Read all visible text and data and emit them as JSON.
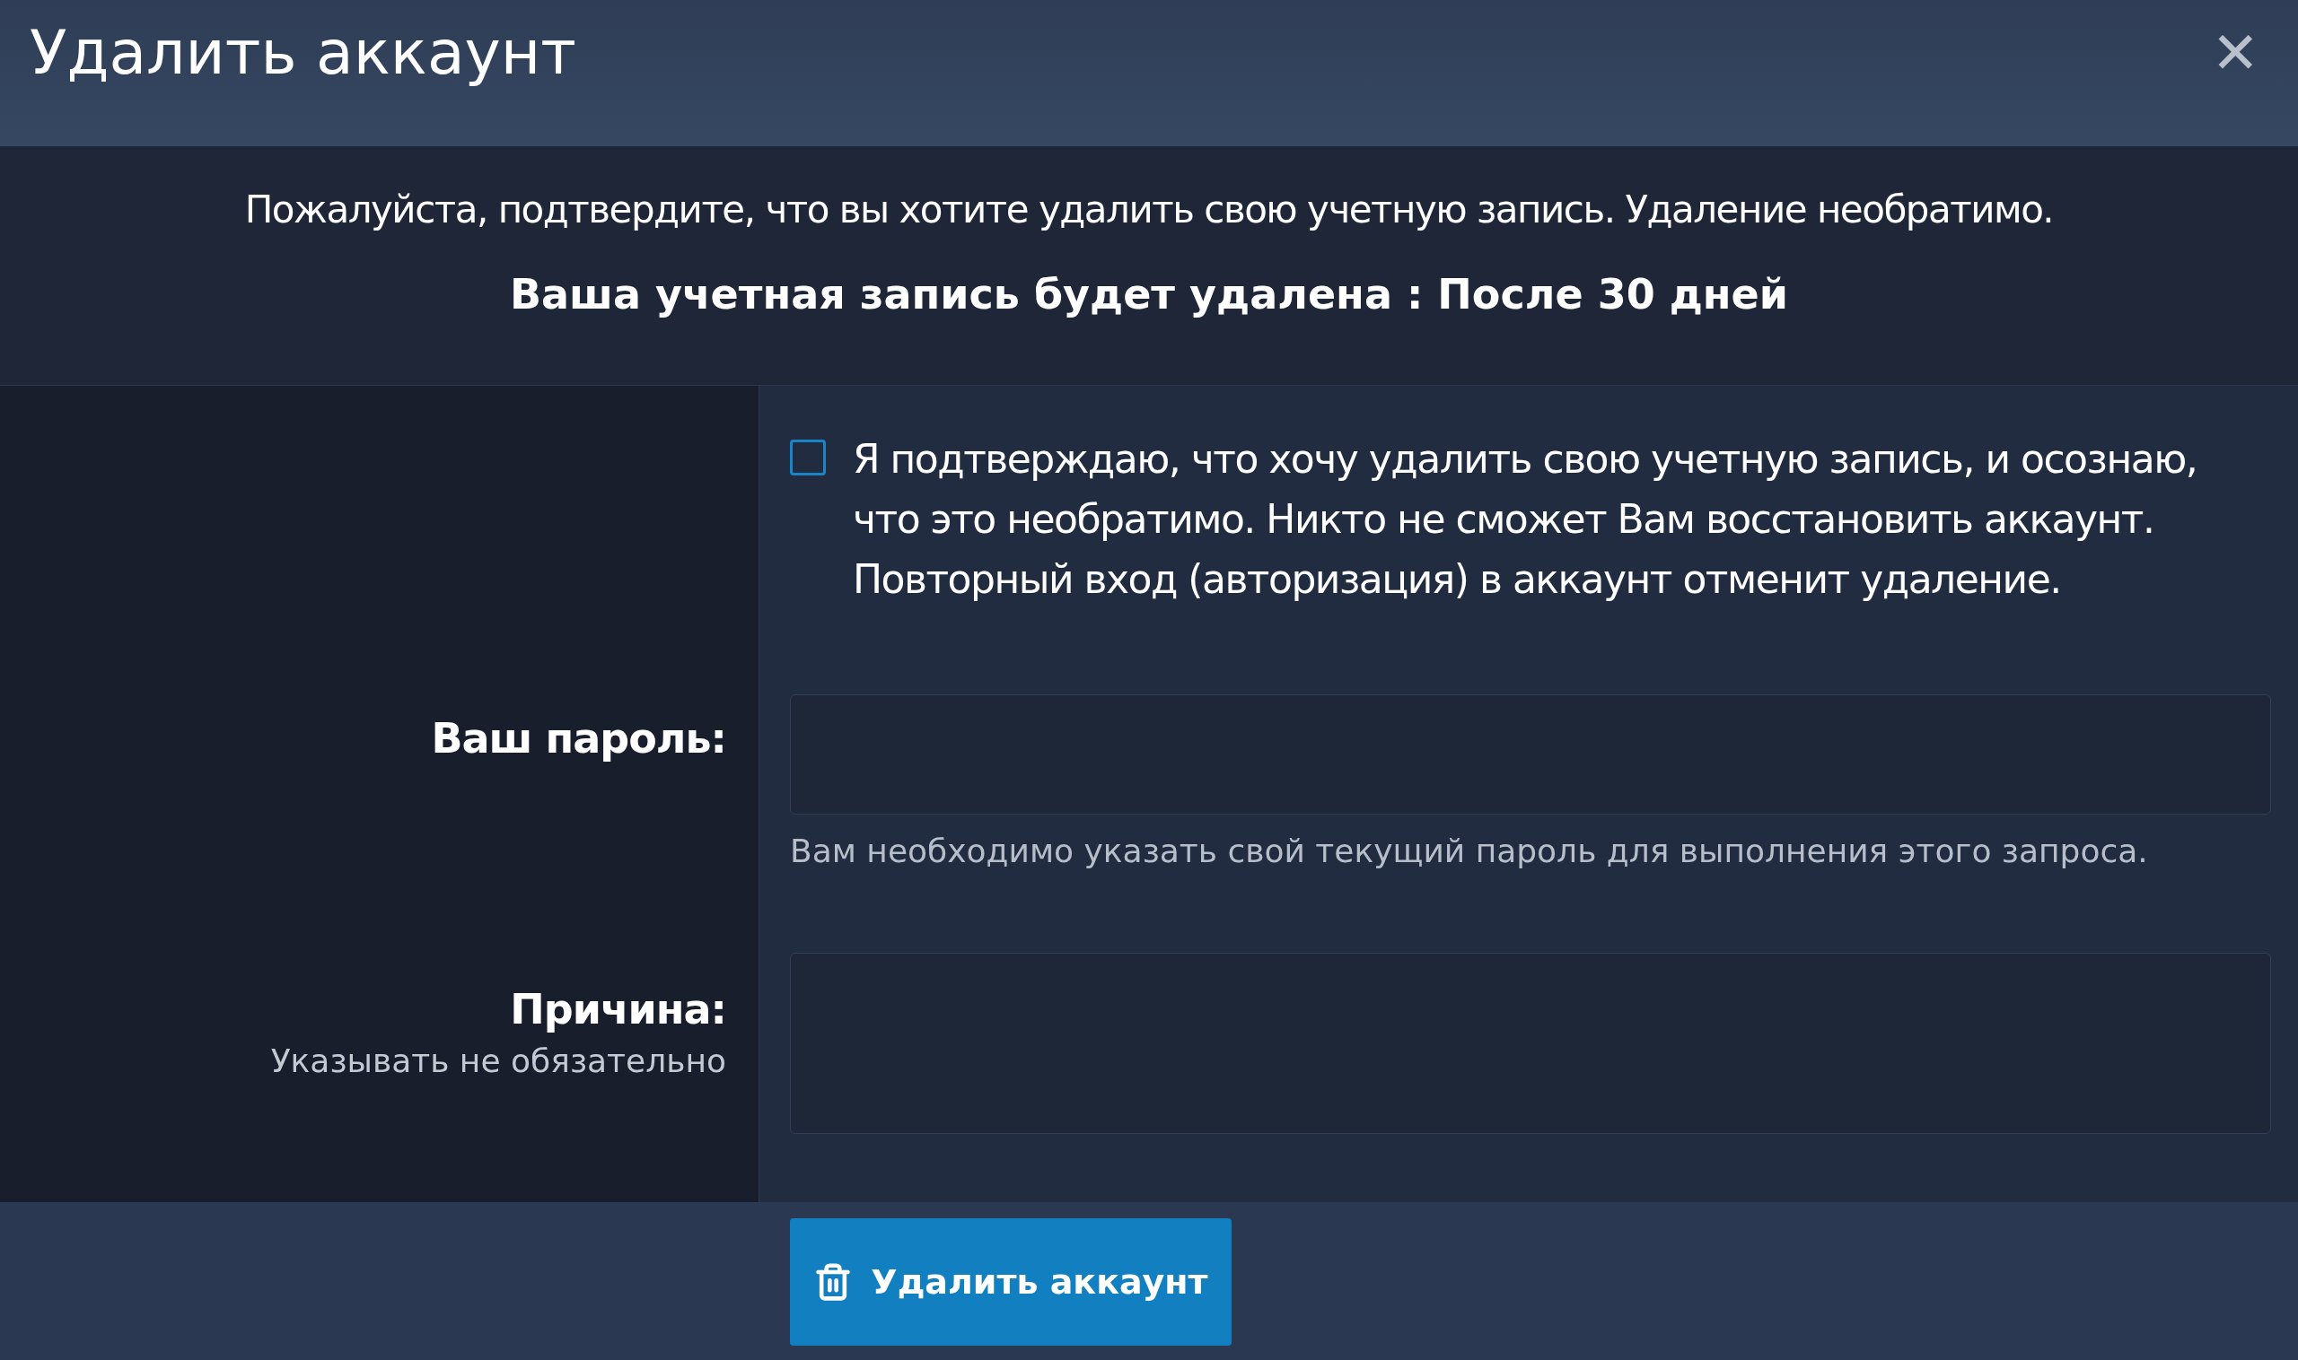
{
  "dialog": {
    "title": "Удалить аккаунт",
    "close": "✕"
  },
  "notice": {
    "message": "Пожалуйста, подтвердите, что вы хотите удалить свою учетную запись. Удаление необратимо.",
    "deadline": "Ваша учетная запись будет удалена : После 30 дней"
  },
  "confirm": {
    "checked": false,
    "label": "Я подтверждаю, что хочу удалить свою учетную запись, и осознаю, что это необратимо. Никто не сможет Вам восстановить аккаунт. Повторный вход (авторизация) в аккаунт отменит удаление."
  },
  "password": {
    "label": "Ваш пароль:",
    "hint": "Вам необходимо указать свой текущий пароль для выполнения этого запроса."
  },
  "reason": {
    "label": "Причина:",
    "sublabel": "Указывать не обязательно"
  },
  "submit": {
    "label": "Удалить аккаунт"
  }
}
